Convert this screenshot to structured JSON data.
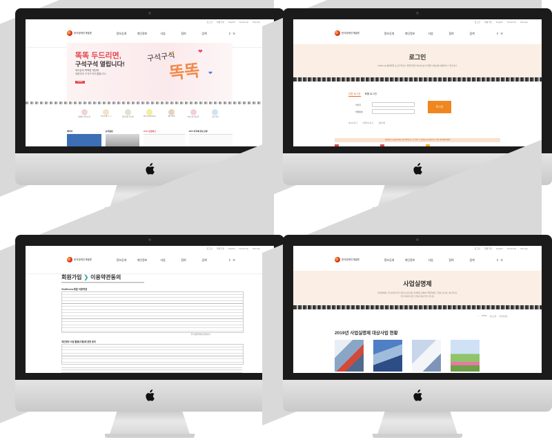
{
  "common": {
    "logo_text": "한국장애인개발원",
    "top_links": [
      "로그인",
      "회원가입",
      "English",
      "Facebook",
      "Sitemap"
    ],
    "nav": [
      "정보공개",
      "개인정보",
      "사업",
      "참여",
      "검색"
    ]
  },
  "screen1": {
    "hero_title_line1": "똑똑 두드리면,",
    "hero_title_line2": "구석구석 열립니다!",
    "hero_sub_line1": "여러분의 똑똑한 제안에",
    "hero_sub_line2": "대한민국 구석구석이 열립니다.",
    "hero_button": "MORE",
    "hero_art_small": "구석구석",
    "hero_art_big": "똑똑",
    "quick_links": [
      "장애인 편의시설",
      "Think BF ( + )",
      "유니버설 디자인",
      "BF Certification",
      "BF LINK",
      "BF조성 매뉴얼",
      "교육·연수"
    ],
    "boards": [
      "배리어",
      "공지알림",
      "BTD 입법예고",
      "BTD 지자체 정보교류"
    ]
  },
  "screen2": {
    "page_title": "로그인",
    "intro": "VisitKorea 통합회원 로그인 입니다. 회원가입을 하시면 보다 다양한 서비스를 이용하실 수 있습니다.",
    "tab_active": "간편 로그인",
    "tab_inactive": "회원 로그인",
    "id_label": "아이디",
    "pw_label": "비밀번호",
    "login_button": "로그인",
    "links": [
      "아이디 찾기",
      "비밀번호 찾기",
      "회원가입"
    ],
    "notice": "개인정보 보호를 위하여 공용 PC에서는 로그아웃 후 이용하시기 바랍니다. 문의: 02-0000-0000"
  },
  "screen3": {
    "heading_main": "회원가입",
    "heading_sub": "이용약관동의",
    "section1_title": "VisitKorea 회원 이용약관",
    "section2_title": "개인정보 수집·활용(이용)에 관한 동의",
    "agree_label": "위 이용약관에 동의합니다."
  },
  "screen4": {
    "banner_title": "사업실명제",
    "banner_desc_line1": "사업실명제는 주요사업의 추진 과정 및 담당자를 국민에게 공개하여 책임행정을 구현하고자 하는 제도입니다.",
    "banner_desc_line2": "국민 여러분의 많은 관심과 참여 부탁드립니다.",
    "breadcrumb": [
      "HOME",
      "정보공개",
      "사업실명제"
    ],
    "section_title": "2019년 사업실명제 대상사업 현황"
  }
}
